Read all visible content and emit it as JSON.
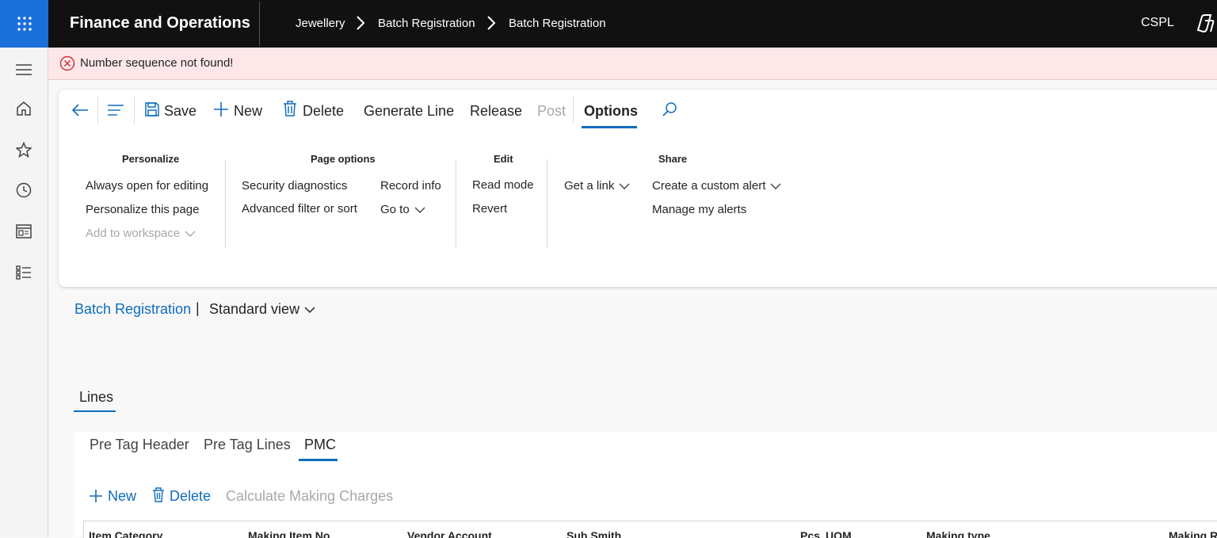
{
  "topbar": {
    "app_title": "Finance and Operations",
    "breadcrumbs": [
      "Jewellery",
      "Batch Registration",
      "Batch Registration"
    ],
    "company": "CSPL"
  },
  "leftnav": {
    "items": [
      "menu-icon",
      "home-icon",
      "favorites-icon",
      "recent-icon",
      "workspaces-icon",
      "modules-icon"
    ]
  },
  "error": {
    "message": "Number sequence not found!",
    "color": "#d13438"
  },
  "toolbar": {
    "save": "Save",
    "new": "New",
    "delete": "Delete",
    "generate_line": "Generate Line",
    "release": "Release",
    "post": "Post",
    "options": "Options"
  },
  "options_pane": {
    "personalize": {
      "title": "Personalize",
      "items": [
        "Always open for editing",
        "Personalize this page",
        "Add to workspace"
      ]
    },
    "page_options": {
      "title": "Page options",
      "items": [
        "Security diagnostics",
        "Advanced filter or sort",
        "Record info",
        "Go to"
      ]
    },
    "edit": {
      "title": "Edit",
      "items": [
        "Read mode",
        "Revert"
      ]
    },
    "share": {
      "title": "Share",
      "items": [
        "Get a link",
        "Create a custom alert",
        "Manage my alerts"
      ]
    }
  },
  "page": {
    "title_link": "Batch Registration",
    "separator": "|",
    "view": "Standard view"
  },
  "lines": {
    "tab": "Lines",
    "subtabs": [
      "Pre Tag Header",
      "Pre Tag Lines",
      "PMC"
    ],
    "actions": {
      "new": "New",
      "delete": "Delete",
      "calculate": "Calculate Making Charges"
    },
    "columns": [
      "Item Category",
      "Making Item No",
      "Vendor Account",
      "Sub Smith",
      "Pcs",
      "UOM",
      "Making type",
      "Making R"
    ]
  },
  "colors": {
    "accent": "#0f6cbd",
    "waffle": "#1b6fd9",
    "topbar": "#111111",
    "error_bg": "#fde7e9"
  }
}
